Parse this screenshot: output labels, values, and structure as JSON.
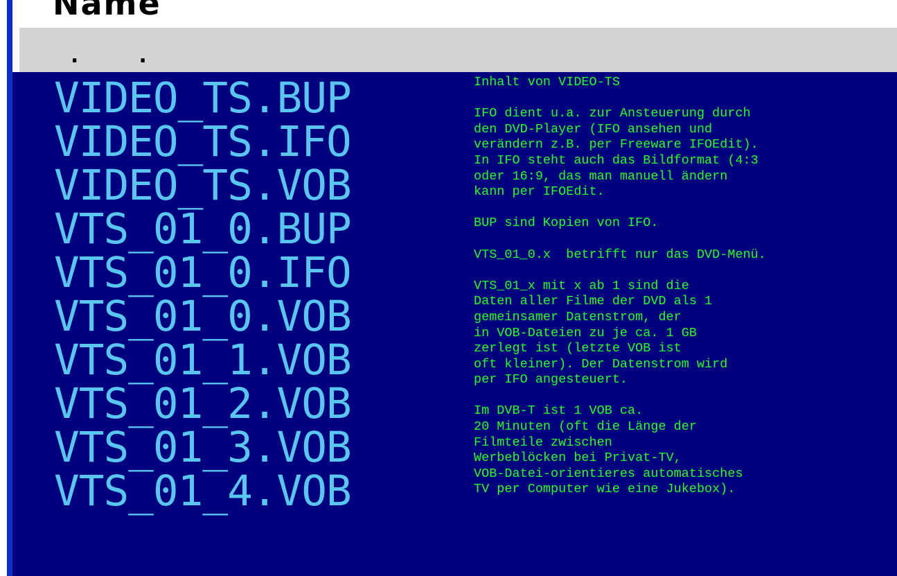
{
  "column_header": "Name",
  "parent_entry": ". .",
  "files": [
    "VIDEO_TS.BUP",
    "VIDEO_TS.IFO",
    "VIDEO_TS.VOB",
    "VTS_01_0.BUP",
    "VTS_01_0.IFO",
    "VTS_01_0.VOB",
    "VTS_01_1.VOB",
    "VTS_01_2.VOB",
    "VTS_01_3.VOB",
    "VTS_01_4.VOB"
  ],
  "info": {
    "p1": [
      "Inhalt von VIDEO-TS"
    ],
    "p2": [
      "IFO dient u.a. zur Ansteuerung durch",
      "den DVD-Player (IFO ansehen und",
      "verändern z.B. per Freeware IFOEdit).",
      "In IFO steht auch das Bildformat (4:3",
      "oder 16:9, das man manuell ändern",
      "kann per IFOEdit."
    ],
    "p3": [
      "BUP sind Kopien von IFO."
    ],
    "p4": [
      "VTS_01_0.x  betrifft nur das DVD-Menü."
    ],
    "p5": [
      "VTS_01_x mit x ab 1 sind die",
      "Daten aller Filme der DVD als 1",
      "gemeinsamer Datenstrom, der",
      "in VOB-Dateien zu je ca. 1 GB",
      "zerlegt ist (letzte VOB ist",
      "oft kleiner). Der Datenstrom wird",
      "per IFO angesteuert."
    ],
    "p6": [
      "Im DVB-T ist 1 VOB ca.",
      "20 Minuten (oft die Länge der",
      "Filmteile zwischen",
      "Werbeblöcken bei Privat-TV,",
      "VOB-Datei-orientieres automatisches",
      "TV per Computer wie eine Jukebox)."
    ]
  },
  "colors": {
    "listing_background": "#00007e",
    "file_text": "#58c6ee",
    "info_text": "#22ff22",
    "header_row": "#d4d4d4",
    "left_stripe": "#0b2fc7"
  }
}
